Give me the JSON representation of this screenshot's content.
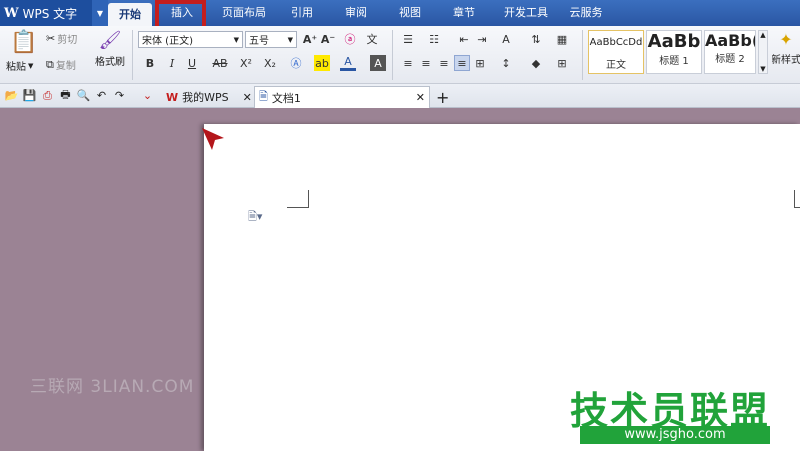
{
  "app": {
    "brand_logo": "W",
    "brand_name": "WPS 文字"
  },
  "menu_tabs": [
    {
      "label": "开始",
      "active": true
    },
    {
      "label": "插入",
      "active": false
    },
    {
      "label": "页面布局",
      "active": false
    },
    {
      "label": "引用",
      "active": false
    },
    {
      "label": "审阅",
      "active": false
    },
    {
      "label": "视图",
      "active": false
    },
    {
      "label": "章节",
      "active": false
    },
    {
      "label": "开发工具",
      "active": false
    },
    {
      "label": "云服务",
      "active": false
    }
  ],
  "ribbon": {
    "paste": "粘贴",
    "cut": "剪切",
    "copy": "复制",
    "format_painter": "格式刷",
    "font_name": "宋体 (正文)",
    "font_size": "五号",
    "styles": [
      {
        "sample": "AaBbCcDd",
        "caption": "正文"
      },
      {
        "sample": "AaBb",
        "caption": "标题 1"
      },
      {
        "sample": "AaBb(",
        "caption": "标题 2"
      }
    ],
    "new_style": "新样式"
  },
  "doc_tabs": [
    {
      "label": "我的WPS"
    },
    {
      "label": "文档1"
    }
  ],
  "watermark": "三联网 3LIAN.COM",
  "site_logo": {
    "name": "技术员联盟",
    "url": "www.jsgho.com"
  },
  "colors": {
    "accent_red": "#c41e1e",
    "brand_blue": "#2a56a3",
    "logo_green": "#21a33a"
  }
}
